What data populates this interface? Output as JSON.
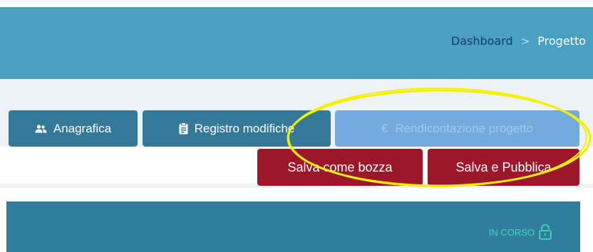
{
  "breadcrumb": {
    "items": [
      "Dashboard"
    ],
    "separator": ">",
    "current": "Progetto"
  },
  "toolbar": {
    "anagrafica_label": "Anagrafica",
    "anagrafica_icon": "users-icon",
    "registro_label": "Registro modifiche",
    "registro_icon": "clipboard-icon",
    "rendicontazione_label": "Rendicontazione progetto",
    "rendicontazione_icon": "euro-icon",
    "rendicontazione_disabled": true,
    "salva_bozza_label": "Salva come bozza",
    "salva_pubblica_label": "Salva e Pubblica"
  },
  "panel": {
    "status_label": "IN CORSO",
    "status_icon": "unlock-icon"
  },
  "colors": {
    "header": "#4aa0c1",
    "primary_button": "#347a98",
    "disabled_button": "#75aade",
    "danger_button": "#9c1729",
    "panel": "#2f7f9c",
    "status": "#45d3c0",
    "annotation": "#f4f000"
  }
}
